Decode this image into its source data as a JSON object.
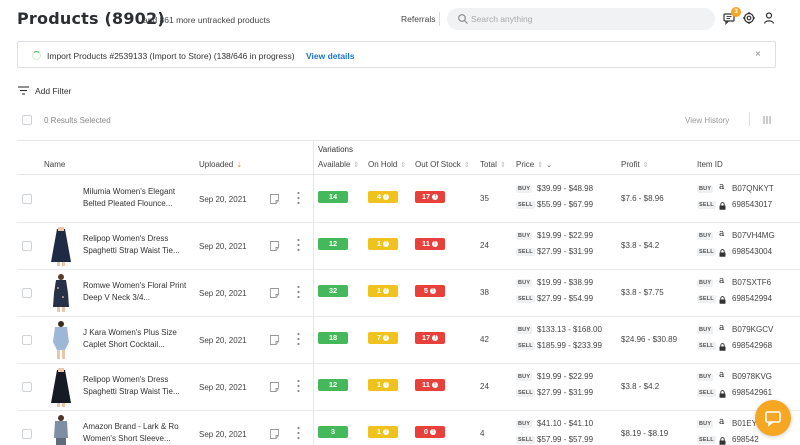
{
  "header": {
    "title": "Products",
    "count": "(8902)",
    "subtitle": "and 861 more untracked products",
    "referrals": "Referrals",
    "search_placeholder": "Search anything",
    "notification_count": "3"
  },
  "banner": {
    "text": "Import Products #2539133 (Import to Store) (138/646 in progress)",
    "link": "View details",
    "close": "×"
  },
  "filter": {
    "label": "Add Filter"
  },
  "selection": {
    "label": "0 Results Selected",
    "view_history": "View History"
  },
  "table": {
    "group_label": "Variations",
    "columns": {
      "name": "Name",
      "uploaded": "Uploaded",
      "available": "Available",
      "on_hold": "On Hold",
      "out_of_stock": "Out Of Stock",
      "total": "Total",
      "price": "Price",
      "profit": "Profit",
      "item_id": "Item ID"
    },
    "buy_tag": "BUY",
    "sell_tag": "SELL",
    "amazon_glyph": "a",
    "rows": [
      {
        "name": "Milumia Women's Elegant Belted Pleated Flounce...",
        "uploaded": "Sep 20, 2021",
        "available": "14",
        "on_hold": "4",
        "out_of_stock": "17",
        "total": "35",
        "buy_price": "$39.99 - $48.98",
        "sell_price": "$55.99 - $67.99",
        "profit": "$7.6 - $8.96",
        "asin": "B07QNKYT",
        "sku": "698543017",
        "has_thumb": false
      },
      {
        "name": "Relipop Women's Dress Spaghetti Strap Waist Tie...",
        "uploaded": "Sep 20, 2021",
        "available": "12",
        "on_hold": "1",
        "out_of_stock": "11",
        "total": "24",
        "buy_price": "$19.99 - $22.99",
        "sell_price": "$27.99 - $31.99",
        "profit": "$3.8 - $4.2",
        "asin": "B07VH4MG",
        "sku": "698543004",
        "has_thumb": true
      },
      {
        "name": "Romwe Women's Floral Print Deep V Neck 3/4...",
        "uploaded": "Sep 20, 2021",
        "available": "32",
        "on_hold": "1",
        "out_of_stock": "5",
        "total": "38",
        "buy_price": "$19.99 - $38.99",
        "sell_price": "$27.99 - $54.99",
        "profit": "$3.8 - $7.75",
        "asin": "B07SXTF6",
        "sku": "698542994",
        "has_thumb": true
      },
      {
        "name": "J Kara Women's Plus Size Caplet Short Cocktail...",
        "uploaded": "Sep 20, 2021",
        "available": "18",
        "on_hold": "7",
        "out_of_stock": "17",
        "total": "42",
        "buy_price": "$133.13 - $168.00",
        "sell_price": "$185.99 - $233.99",
        "profit": "$24.96 - $30.89",
        "asin": "B079KGCV",
        "sku": "698542968",
        "has_thumb": true
      },
      {
        "name": "Relipop Women's Dress Spaghetti Strap Waist Tie...",
        "uploaded": "Sep 20, 2021",
        "available": "12",
        "on_hold": "1",
        "out_of_stock": "11",
        "total": "24",
        "buy_price": "$19.99 - $22.99",
        "sell_price": "$27.99 - $31.99",
        "profit": "$3.8 - $4.2",
        "asin": "B0978KVG",
        "sku": "698542961",
        "has_thumb": true
      },
      {
        "name": "Amazon Brand - Lark & Ro Women's Short Sleeve...",
        "uploaded": "Sep 20, 2021",
        "available": "3",
        "on_hold": "1",
        "out_of_stock": "0",
        "total": "4",
        "buy_price": "$41.10 - $41.10",
        "sell_price": "$57.99 - $57.99",
        "profit": "$8.19 - $8.19",
        "asin": "B01EY",
        "sku": "698542",
        "has_thumb": true
      }
    ]
  },
  "colors": {
    "available": "#44b85a",
    "on_hold": "#f0c21d",
    "out_of_stock": "#e8413c",
    "link": "#1a73d8",
    "accent": "#f5a623"
  },
  "icons": [
    "search-icon",
    "chat-icon",
    "settings-icon",
    "user-icon",
    "filter-icon",
    "columns-icon",
    "note-icon",
    "more-vertical-icon",
    "lock-icon",
    "amazon-icon",
    "spinner-icon",
    "close-icon"
  ]
}
